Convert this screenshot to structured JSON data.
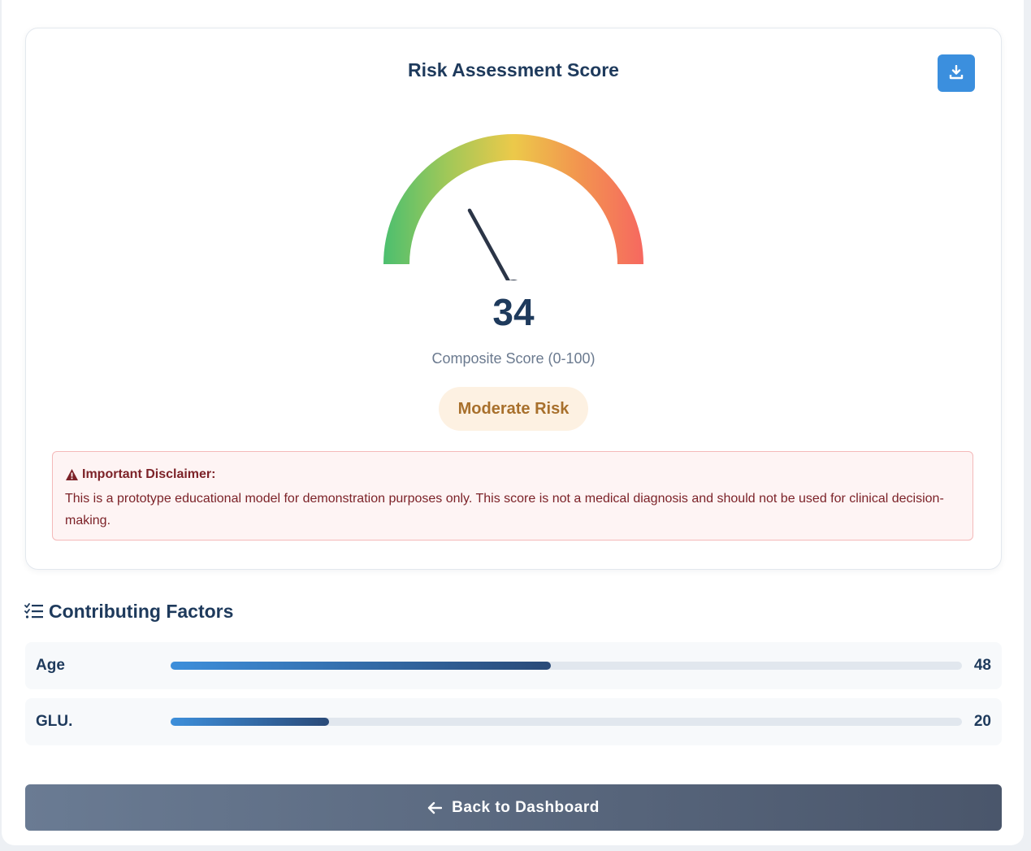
{
  "card": {
    "title": "Risk Assessment Score",
    "download_icon": "download-icon"
  },
  "gauge": {
    "score": 34,
    "min": 0,
    "max": 100,
    "colors": [
      "#4cbf6f",
      "#a2c858",
      "#ecc94a",
      "#f2954f",
      "#f66860"
    ],
    "needle_color": "#2b3547"
  },
  "score": {
    "value": "34",
    "label": "Composite Score (0-100)"
  },
  "risk": {
    "label": "Moderate Risk"
  },
  "disclaimer": {
    "icon": "warning-icon",
    "title": "Important Disclaimer:",
    "text": "This is a prototype educational model for demonstration purposes only. This score is not a medical diagnosis and should not be used for clinical decision-making."
  },
  "factors": {
    "heading": "Contributing Factors",
    "icon": "checklist-icon",
    "items": [
      {
        "name": "Age",
        "value": "48",
        "fill_percent": 48
      },
      {
        "name": "GLU.",
        "value": "20",
        "fill_percent": 20
      }
    ]
  },
  "back_button": {
    "label": "Back to Dashboard",
    "icon": "arrow-left-icon"
  }
}
